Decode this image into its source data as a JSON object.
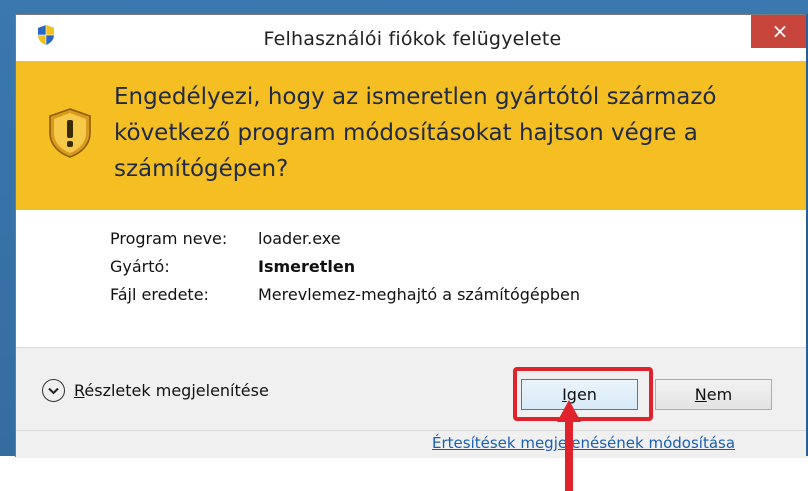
{
  "window": {
    "title": "Felhasználói fiókok felügyelete",
    "close_glyph": "×"
  },
  "banner": {
    "question": "Engedélyezi, hogy az ismeretlen gyártótól származó következő program módosításokat hajtson végre a számítógépen?",
    "icon": "warning-shield-icon",
    "color": "#f5be23"
  },
  "program_info": {
    "rows": [
      {
        "label": "Program neve:",
        "value": "loader.exe"
      },
      {
        "label": "Gyártó:",
        "value": "Ismeretlen"
      },
      {
        "label": "Fájl eredete:",
        "value": "Merevlemez-meghajtó a számítógépben"
      }
    ]
  },
  "details": {
    "label_ul": "R",
    "label_rest": "észletek megjelenítése"
  },
  "buttons": {
    "yes_ul": "I",
    "yes_rest": "gen",
    "no_ul": "N",
    "no_rest": "em"
  },
  "notify_link": "Értesítések megjelenésének módosítása",
  "annotation": {
    "highlight_color": "#e0222c"
  }
}
